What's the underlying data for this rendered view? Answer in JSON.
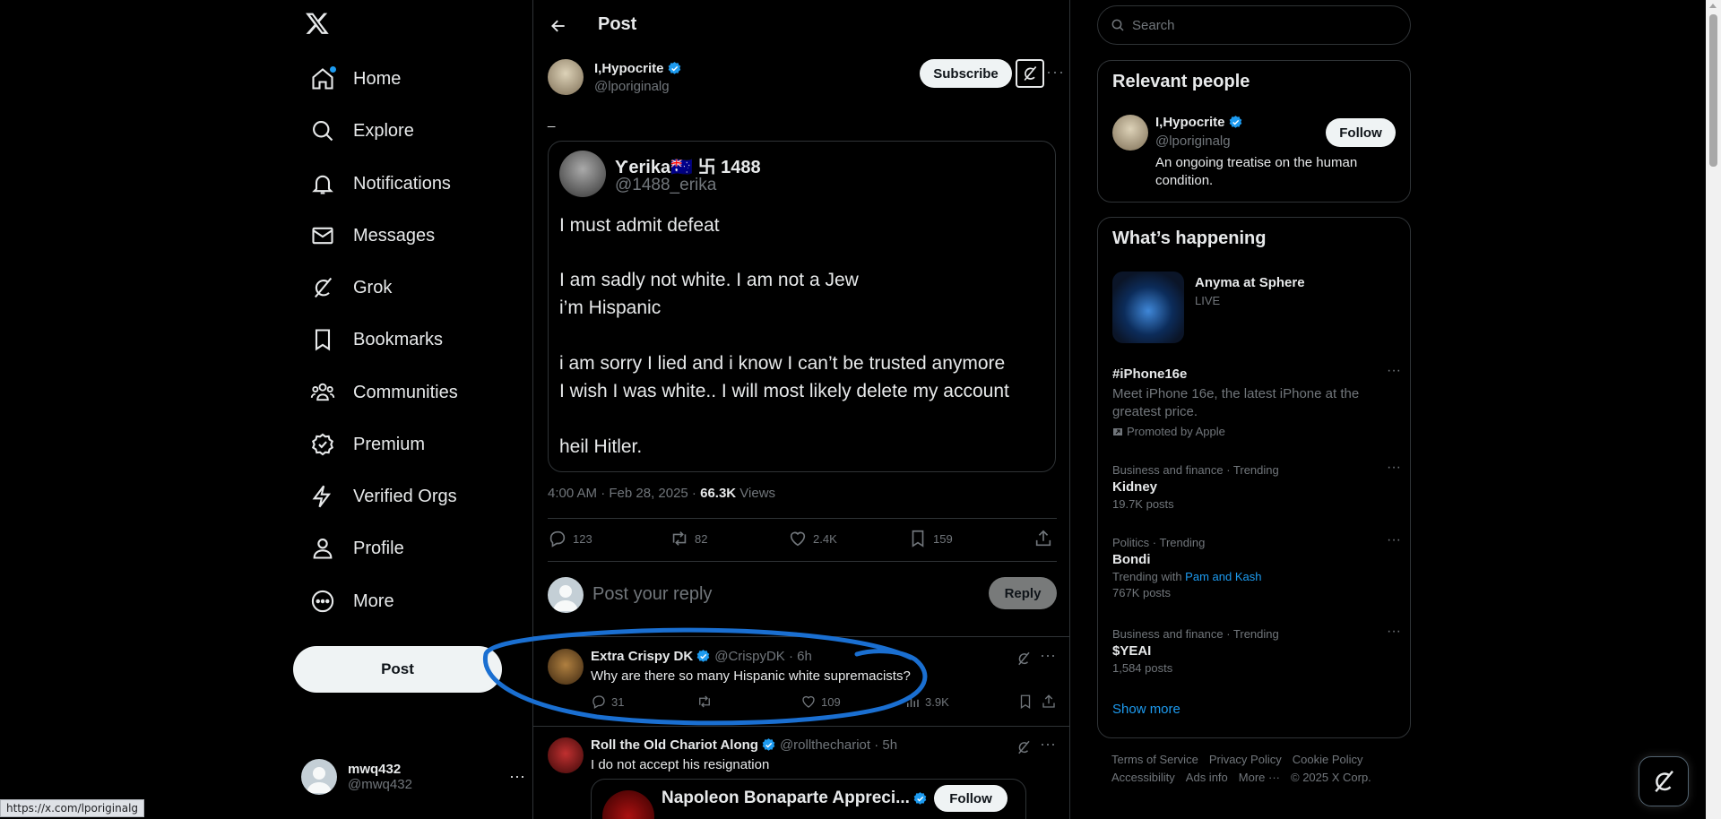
{
  "nav": {
    "items": [
      {
        "label": "Home",
        "icon": "home-icon"
      },
      {
        "label": "Explore",
        "icon": "search-icon"
      },
      {
        "label": "Notifications",
        "icon": "bell-icon"
      },
      {
        "label": "Messages",
        "icon": "envelope-icon"
      },
      {
        "label": "Grok",
        "icon": "grok-icon"
      },
      {
        "label": "Bookmarks",
        "icon": "bookmark-icon"
      },
      {
        "label": "Communities",
        "icon": "people-icon"
      },
      {
        "label": "Premium",
        "icon": "verified-icon"
      },
      {
        "label": "Verified Orgs",
        "icon": "bolt-icon"
      },
      {
        "label": "Profile",
        "icon": "person-icon"
      },
      {
        "label": "More",
        "icon": "more-circle-icon"
      }
    ],
    "post_label": "Post",
    "account": {
      "name": "mwq432",
      "handle": "@mwq432"
    }
  },
  "header": {
    "title": "Post"
  },
  "post": {
    "author_name": "I,Hypocrite",
    "author_handle": "@lporiginalg",
    "subscribe_label": "Subscribe",
    "text": "_",
    "image": {
      "name": "Ƴerika🇦🇺 卐 1488",
      "handle": "@1488_erika",
      "lines": [
        "I must admit defeat",
        "I am sadly not white. I am not a Jew",
        "i’m Hispanic",
        "i am sorry I lied and i know I can’t be trusted anymore",
        "I wish I was white.. I will most likely delete my account",
        "heil Hitler."
      ]
    },
    "timestamp": "4:00 AM · Feb 28, 2025 · ",
    "views_count": "66.3K",
    "views_label": " Views",
    "stats": {
      "replies": "123",
      "reposts": "82",
      "likes": "2.4K",
      "bookmarks": "159"
    }
  },
  "reply_box": {
    "placeholder": "Post your reply",
    "button": "Reply"
  },
  "replies": [
    {
      "name": "Extra Crispy DK",
      "handle": "@CrispyDK · 6h",
      "text": "Why are there so many Hispanic white supremacists?",
      "comments": "31",
      "likes": "109",
      "views": "3.9K"
    },
    {
      "name": "Roll the Old Chariot Along",
      "handle": "@rollthechariot · 5h",
      "text": "I do not accept his resignation",
      "quote_name": "Napoleon Bonaparte Appreci...",
      "quote_follow": "Follow"
    }
  ],
  "right": {
    "search_placeholder": "Search",
    "relevant_title": "Relevant people",
    "relevant": {
      "name": "I,Hypocrite",
      "handle": "@lporiginalg",
      "bio": "An ongoing treatise on the human condition.",
      "follow": "Follow"
    },
    "happening_title": "What’s happening",
    "live": {
      "title": "Anyma at Sphere",
      "status": "LIVE"
    },
    "trends": [
      {
        "title": "#iPhone16e",
        "desc": "Meet iPhone 16e, the latest iPhone at the greatest price.",
        "promo": "Promoted by Apple"
      },
      {
        "context": "Business and finance · Trending",
        "title": "Kidney",
        "count": "19.7K posts"
      },
      {
        "context": "Politics · Trending",
        "title": "Bondi",
        "with_prefix": "Trending with ",
        "with_link": "Pam and Kash",
        "count": "767K posts"
      },
      {
        "context": "Business and finance · Trending",
        "title": "$YEAI",
        "count": "1,584 posts"
      }
    ],
    "show_more": "Show more",
    "footer": [
      "Terms of Service",
      "Privacy Policy",
      "Cookie Policy",
      "Accessibility",
      "Ads info",
      "More ···",
      "© 2025 X Corp."
    ]
  },
  "status_url": "https://x.com/lporiginalg",
  "colors": {
    "accent": "#1d9bf0",
    "annotation": "#1a6fd1",
    "background": "#000000",
    "border": "#2f3336",
    "muted": "#71767b"
  }
}
